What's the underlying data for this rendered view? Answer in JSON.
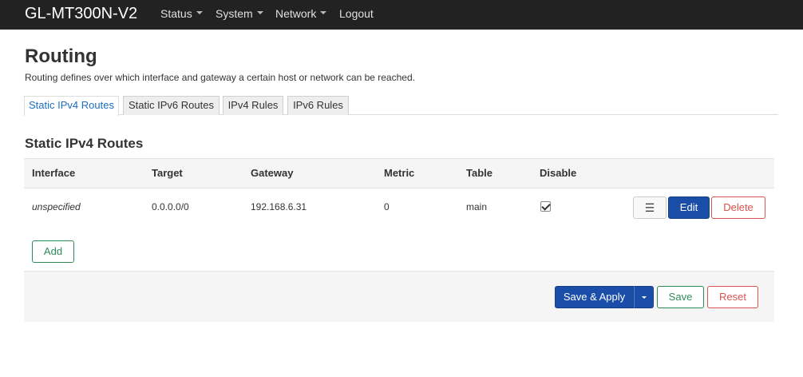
{
  "navbar": {
    "brand": "GL-MT300N-V2",
    "menu": [
      {
        "label": "Status",
        "has_dropdown": true
      },
      {
        "label": "System",
        "has_dropdown": true
      },
      {
        "label": "Network",
        "has_dropdown": true
      },
      {
        "label": "Logout",
        "has_dropdown": false
      }
    ]
  },
  "page": {
    "title": "Routing",
    "description": "Routing defines over which interface and gateway a certain host or network can be reached."
  },
  "tabs": [
    {
      "label": "Static IPv4 Routes",
      "active": true
    },
    {
      "label": "Static IPv6 Routes",
      "active": false
    },
    {
      "label": "IPv4 Rules",
      "active": false
    },
    {
      "label": "IPv6 Rules",
      "active": false
    }
  ],
  "section": {
    "title": "Static IPv4 Routes",
    "columns": [
      "Interface",
      "Target",
      "Gateway",
      "Metric",
      "Table",
      "Disable"
    ],
    "rows": [
      {
        "interface": "unspecified",
        "target": "0.0.0.0/0",
        "gateway": "192.168.6.31",
        "metric": "0",
        "table": "main",
        "disable": true,
        "drag_icon": "☰",
        "edit_label": "Edit",
        "delete_label": "Delete"
      }
    ],
    "add_label": "Add"
  },
  "footer": {
    "save_apply_label": "Save & Apply",
    "save_label": "Save",
    "reset_label": "Reset"
  },
  "colors": {
    "navbar_bg": "#222222",
    "primary": "#1a4ea8",
    "success": "#2e8b57",
    "danger": "#d9534f",
    "active_tab_text": "#1c6ec1"
  }
}
